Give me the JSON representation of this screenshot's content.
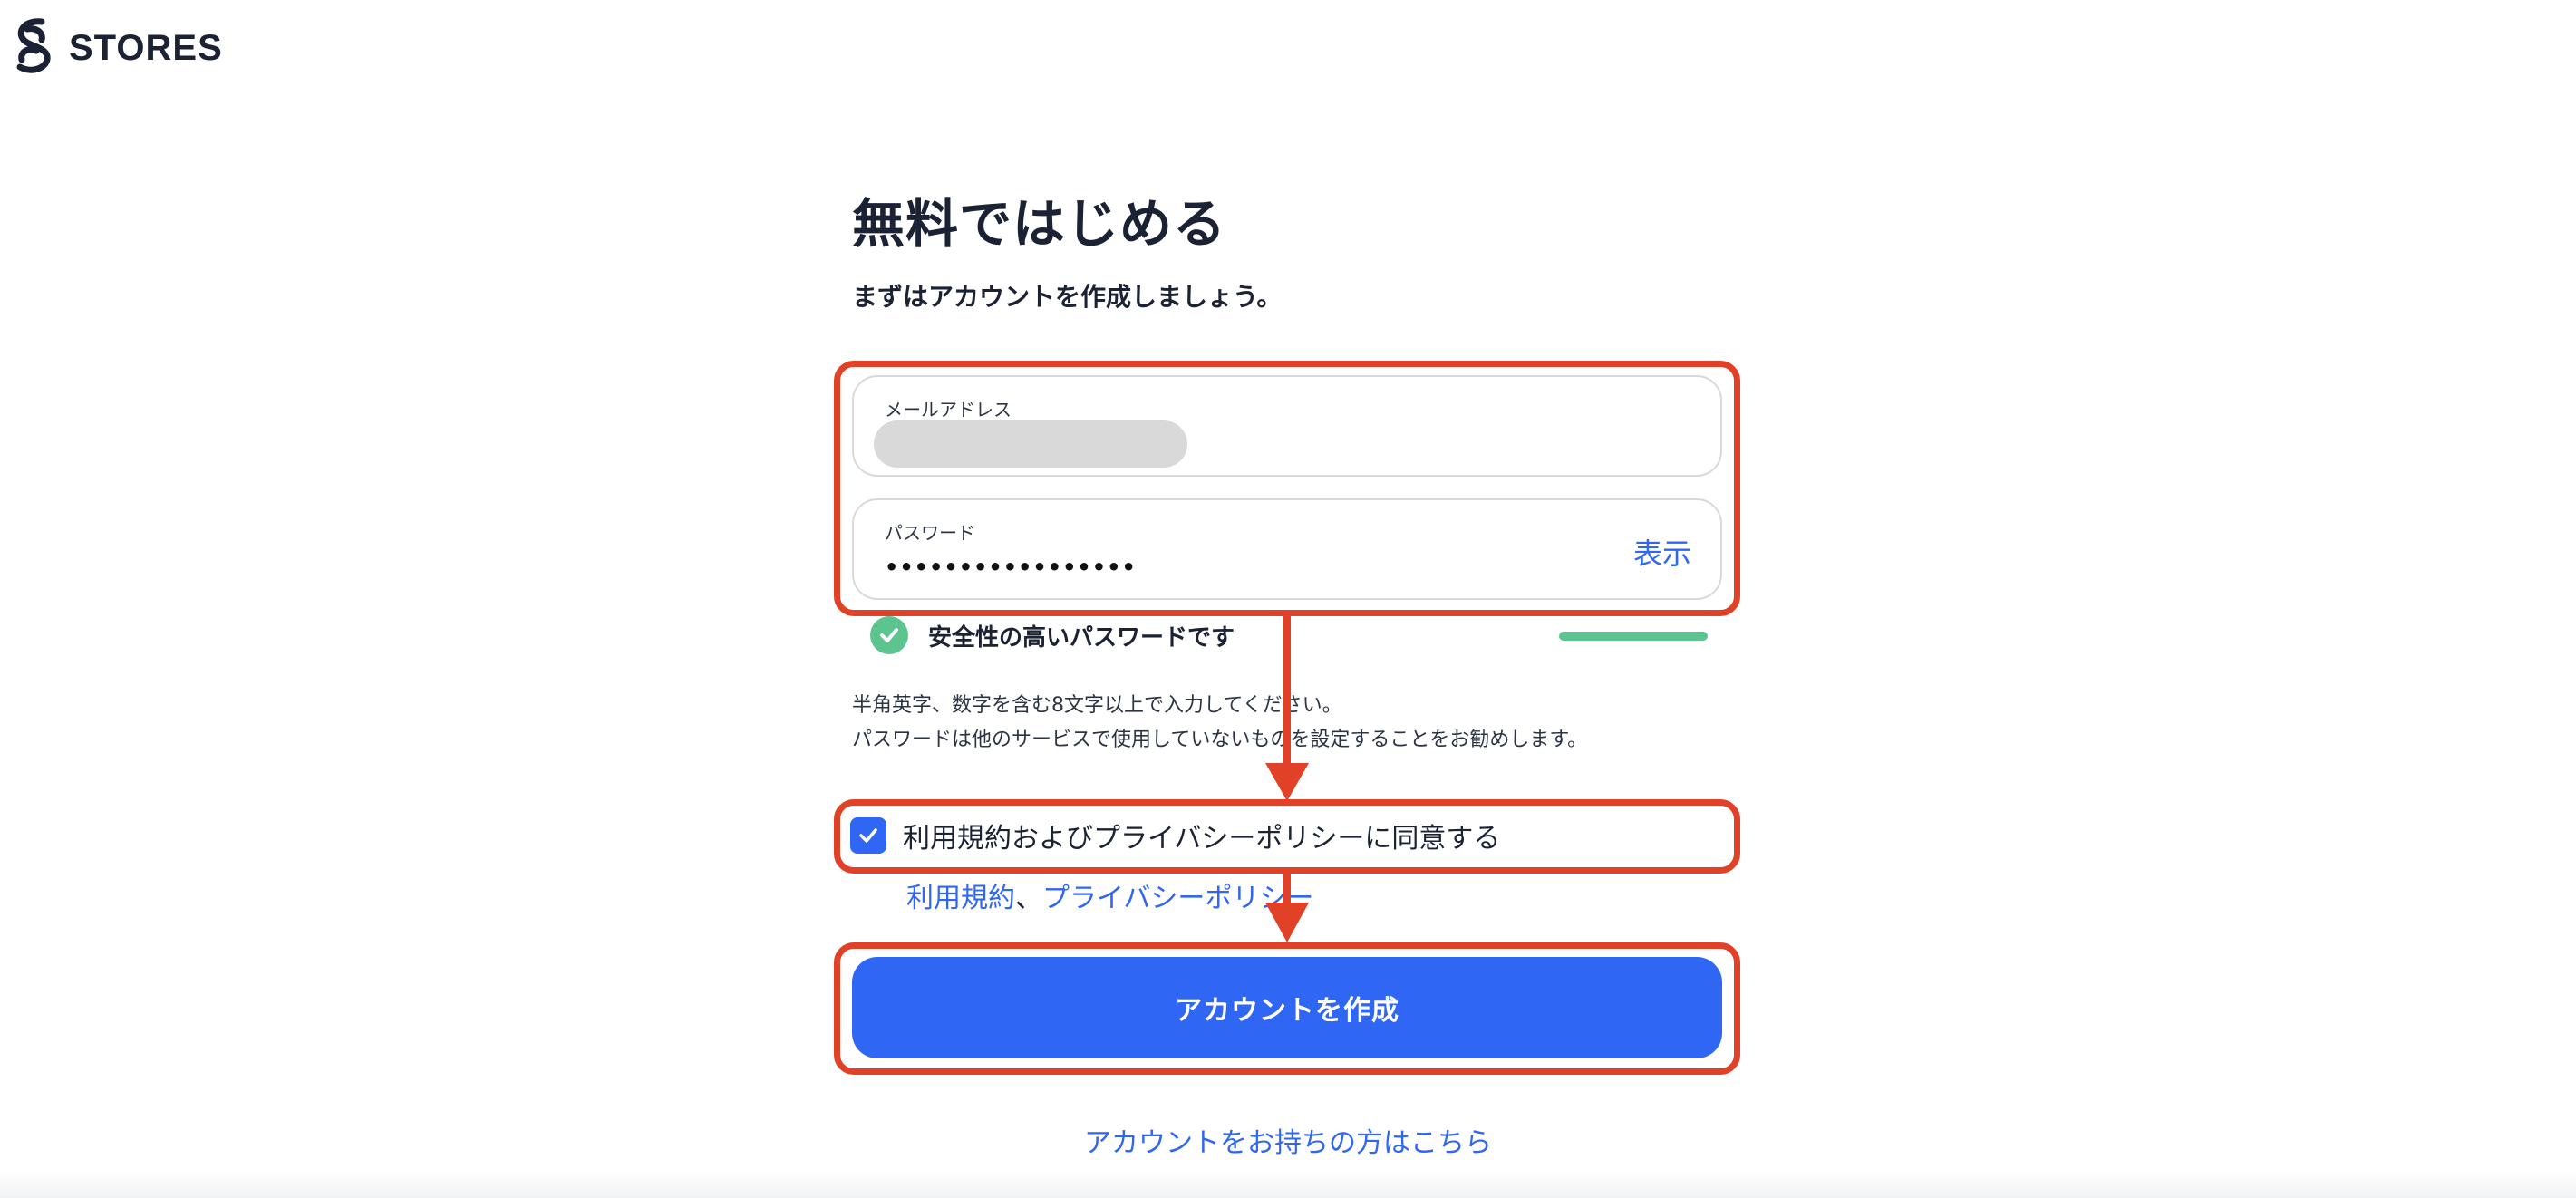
{
  "brand": {
    "name": "STORES"
  },
  "page": {
    "title": "無料ではじめる",
    "subtitle": "まずはアカウントを作成しましょう。"
  },
  "form": {
    "email_label": "メールアドレス",
    "password_label": "パスワード",
    "password_value": "•••••••••••••••••",
    "show_label": "表示",
    "strength_text": "安全性の高いパスワードです",
    "strength_level": 1.0,
    "hint_line1": "半角英字、数字を含む8文字以上で入力してください。",
    "hint_line2": "パスワードは他のサービスで使用していないものを設定することをお勧めします。",
    "agree_label": "利用規約およびプライバシーポリシーに同意する",
    "agree_checked": true,
    "terms_link": "利用規約",
    "link_separator": "、",
    "privacy_link": "プライバシーポリシー",
    "create_button": "アカウントを作成",
    "login_link": "アカウントをお持ちの方はこちら"
  },
  "colors": {
    "accent": "#2f66f3",
    "success": "#5cc58f",
    "annotation": "#e04127",
    "text": "#1b2233"
  },
  "icons": {
    "logo": "stores-logo-icon",
    "strength": "check-circle-icon",
    "checkbox": "checkmark-icon"
  }
}
